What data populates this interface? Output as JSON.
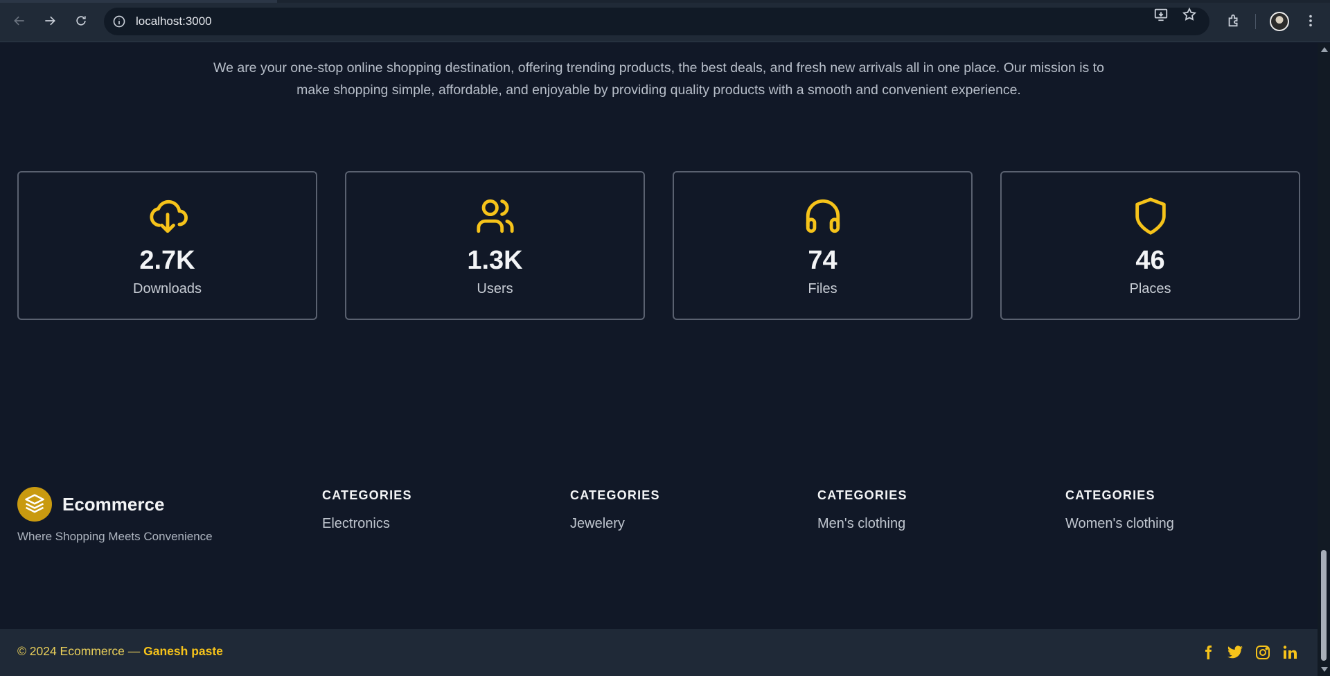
{
  "browser": {
    "url": "localhost:3000",
    "icons": [
      "back-arrow-icon",
      "forward-arrow-icon",
      "reload-icon",
      "site-info-icon",
      "install-app-icon",
      "bookmark-star-icon",
      "extensions-icon",
      "profile-avatar",
      "kebab-menu-icon"
    ]
  },
  "about": {
    "mission": "We are your one-stop online shopping destination, offering trending products, the best deals, and fresh new arrivals all in one place. Our mission is to make shopping simple, affordable, and enjoyable by providing quality products with a smooth and convenient experience."
  },
  "stats": [
    {
      "icon": "cloud-download-icon",
      "value": "2.7K",
      "label": "Downloads"
    },
    {
      "icon": "users-icon",
      "value": "1.3K",
      "label": "Users"
    },
    {
      "icon": "headphones-icon",
      "value": "74",
      "label": "Files"
    },
    {
      "icon": "shield-icon",
      "value": "46",
      "label": "Places"
    }
  ],
  "footer": {
    "brand": {
      "name": "Ecommerce",
      "tagline": "Where Shopping Meets Convenience",
      "logo_icon": "layers-icon"
    },
    "columns": [
      {
        "heading": "CATEGORIES",
        "link": "Electronics"
      },
      {
        "heading": "CATEGORIES",
        "link": "Jewelery"
      },
      {
        "heading": "CATEGORIES",
        "link": "Men's clothing"
      },
      {
        "heading": "CATEGORIES",
        "link": "Women's clothing"
      }
    ],
    "copyright_prefix": "© 2024 Ecommerce — ",
    "author": "Ganesh paste",
    "social": [
      "facebook-icon",
      "twitter-icon",
      "instagram-icon",
      "linkedin-icon"
    ]
  },
  "colors": {
    "background": "#111827",
    "accent": "#f6c31a",
    "bottom_bar": "#1f2937"
  }
}
